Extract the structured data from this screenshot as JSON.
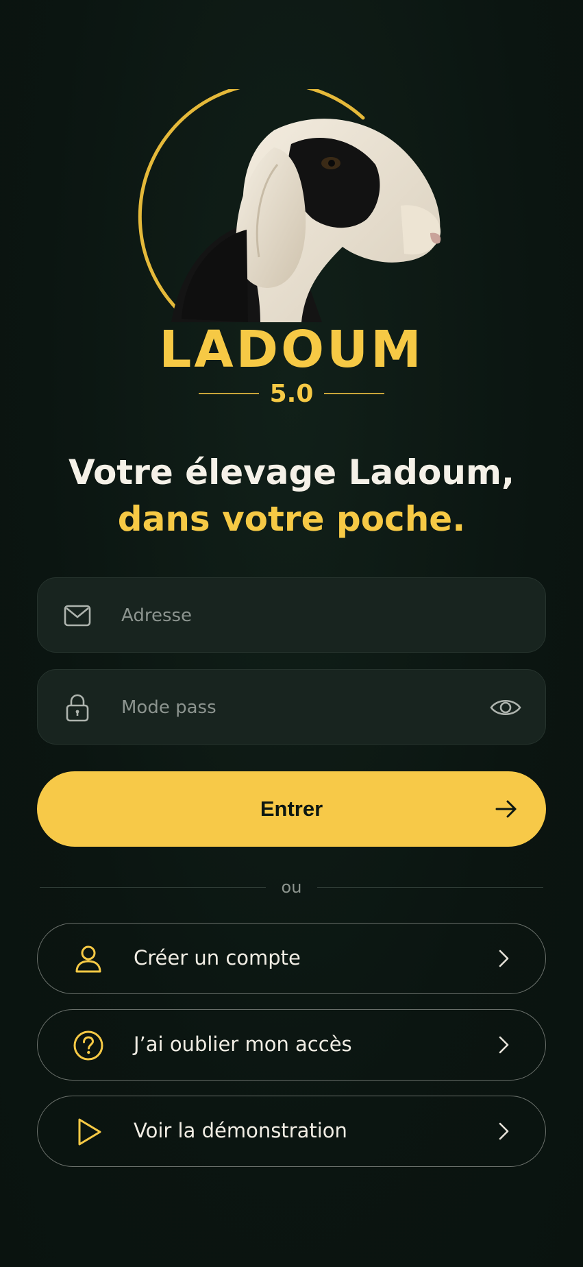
{
  "brand": {
    "name": "LADOUM",
    "version": "5.0"
  },
  "headline": {
    "line1": "Votre élevage Ladoum,",
    "line2": "dans votre poche."
  },
  "form": {
    "email": {
      "placeholder": "Adresse",
      "icon": "mail-icon"
    },
    "password": {
      "placeholder": "Mode pass",
      "icon": "lock-icon",
      "toggle_icon": "eye-icon"
    },
    "submit": {
      "label": "Entrer",
      "icon": "arrow-right-icon"
    }
  },
  "divider": {
    "label": "ou"
  },
  "options": [
    {
      "label": "Créer un compte",
      "icon": "user-icon"
    },
    {
      "label": "J’ai oublier mon accès",
      "icon": "help-circle-icon"
    },
    {
      "label": "Voir la démonstration",
      "icon": "play-icon"
    }
  ],
  "colors": {
    "background": "#0c1712",
    "accent": "#f7c948",
    "field": "#18241f",
    "text": "#f3efe6"
  }
}
